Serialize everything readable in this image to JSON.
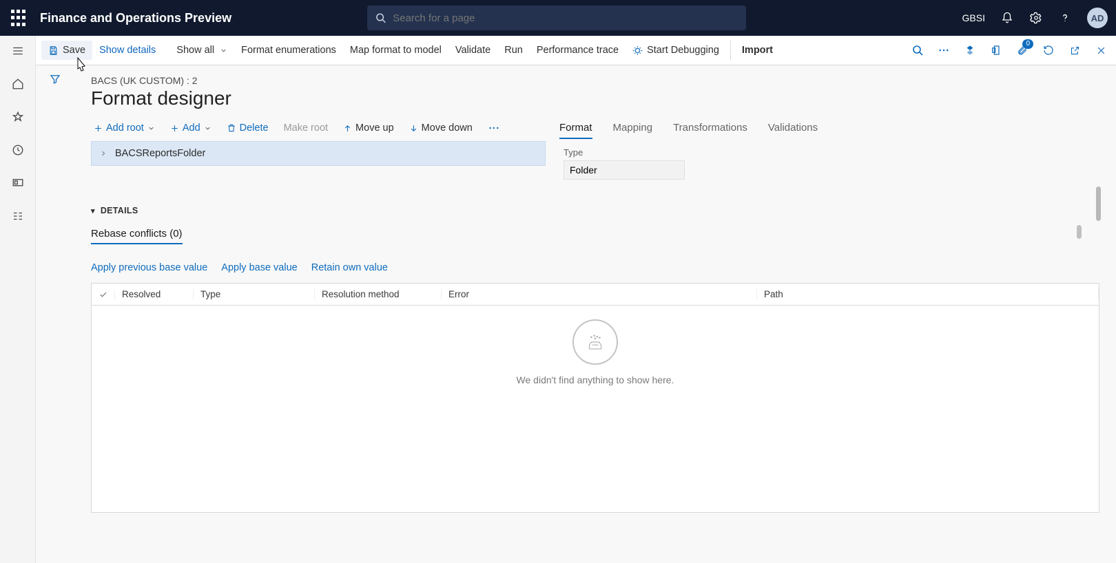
{
  "appTitle": "Finance and Operations Preview",
  "search": {
    "placeholder": "Search for a page"
  },
  "topRight": {
    "company": "GBSI",
    "avatar": "AD"
  },
  "commandBar": {
    "save": "Save",
    "showDetails": "Show details",
    "showAll": "Show all",
    "formatEnum": "Format enumerations",
    "mapFormat": "Map format to model",
    "validate": "Validate",
    "run": "Run",
    "perfTrace": "Performance trace",
    "startDebug": "Start Debugging",
    "importLabel": "Import",
    "badgeCount": "0"
  },
  "breadcrumb": "BACS (UK CUSTOM) : 2",
  "pageTitle": "Format designer",
  "designerToolbar": {
    "addRoot": "Add root",
    "add": "Add",
    "deleteLabel": "Delete",
    "makeRoot": "Make root",
    "moveUp": "Move up",
    "moveDown": "Move down"
  },
  "tree": {
    "rootNode": "BACSReportsFolder"
  },
  "rightTabs": {
    "format": "Format",
    "mapping": "Mapping",
    "transformations": "Transformations",
    "validations": "Validations"
  },
  "typeField": {
    "label": "Type",
    "value": "Folder"
  },
  "detailsLabel": "DETAILS",
  "subtab": "Rebase conflicts (0)",
  "applyBar": {
    "prev": "Apply previous base value",
    "apply": "Apply base value",
    "retain": "Retain own value"
  },
  "columns": {
    "resolved": "Resolved",
    "type": "Type",
    "resMethod": "Resolution method",
    "error": "Error",
    "path": "Path"
  },
  "emptyMsg": "We didn't find anything to show here."
}
